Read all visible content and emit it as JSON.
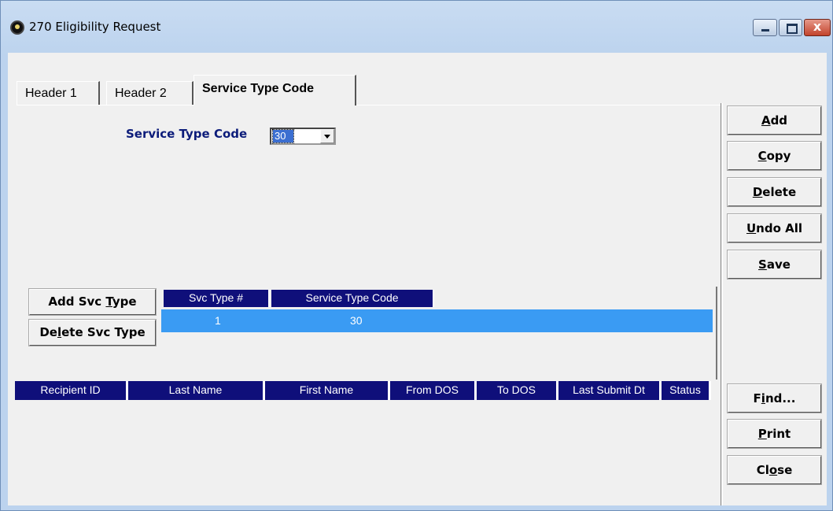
{
  "window": {
    "title": "270 Eligibility Request",
    "close_glyph": "x"
  },
  "tabs": [
    {
      "label": "Header 1",
      "active": false
    },
    {
      "label": "Header 2",
      "active": false
    },
    {
      "label": "Service Type Code",
      "active": true
    }
  ],
  "service_type": {
    "label": "Service Type Code",
    "selected_value": "30"
  },
  "svc_buttons": {
    "add": {
      "pre": "Add  Svc ",
      "u": "T",
      "post": "ype"
    },
    "delete": {
      "pre": "De",
      "u": "l",
      "post": "ete Svc Type"
    }
  },
  "svc_grid": {
    "columns": [
      "Svc Type #",
      "Service Type Code"
    ],
    "rows": [
      {
        "svc_type_no": "1",
        "service_type_code": "30",
        "selected": true
      }
    ]
  },
  "recipient_grid": {
    "columns": [
      "Recipient ID",
      "Last Name",
      "First Name",
      "From DOS",
      "To DOS",
      "Last Submit Dt",
      "Status"
    ]
  },
  "side_buttons": {
    "add": {
      "pre": "",
      "u": "A",
      "post": "dd"
    },
    "copy": {
      "pre": "",
      "u": "C",
      "post": "opy"
    },
    "delete": {
      "pre": "",
      "u": "D",
      "post": "elete"
    },
    "undo_all": {
      "pre": "",
      "u": "U",
      "post": "ndo All"
    },
    "save": {
      "pre": "",
      "u": "S",
      "post": "ave"
    },
    "find": {
      "pre": "F",
      "u": "i",
      "post": "nd..."
    },
    "print": {
      "pre": "",
      "u": "P",
      "post": "rint"
    },
    "close": {
      "pre": "Cl",
      "u": "o",
      "post": "se"
    }
  },
  "colors": {
    "grid_header": "#0f0f7a",
    "selected_row": "#3a9bf3",
    "label_blue": "#0c1c7a"
  }
}
